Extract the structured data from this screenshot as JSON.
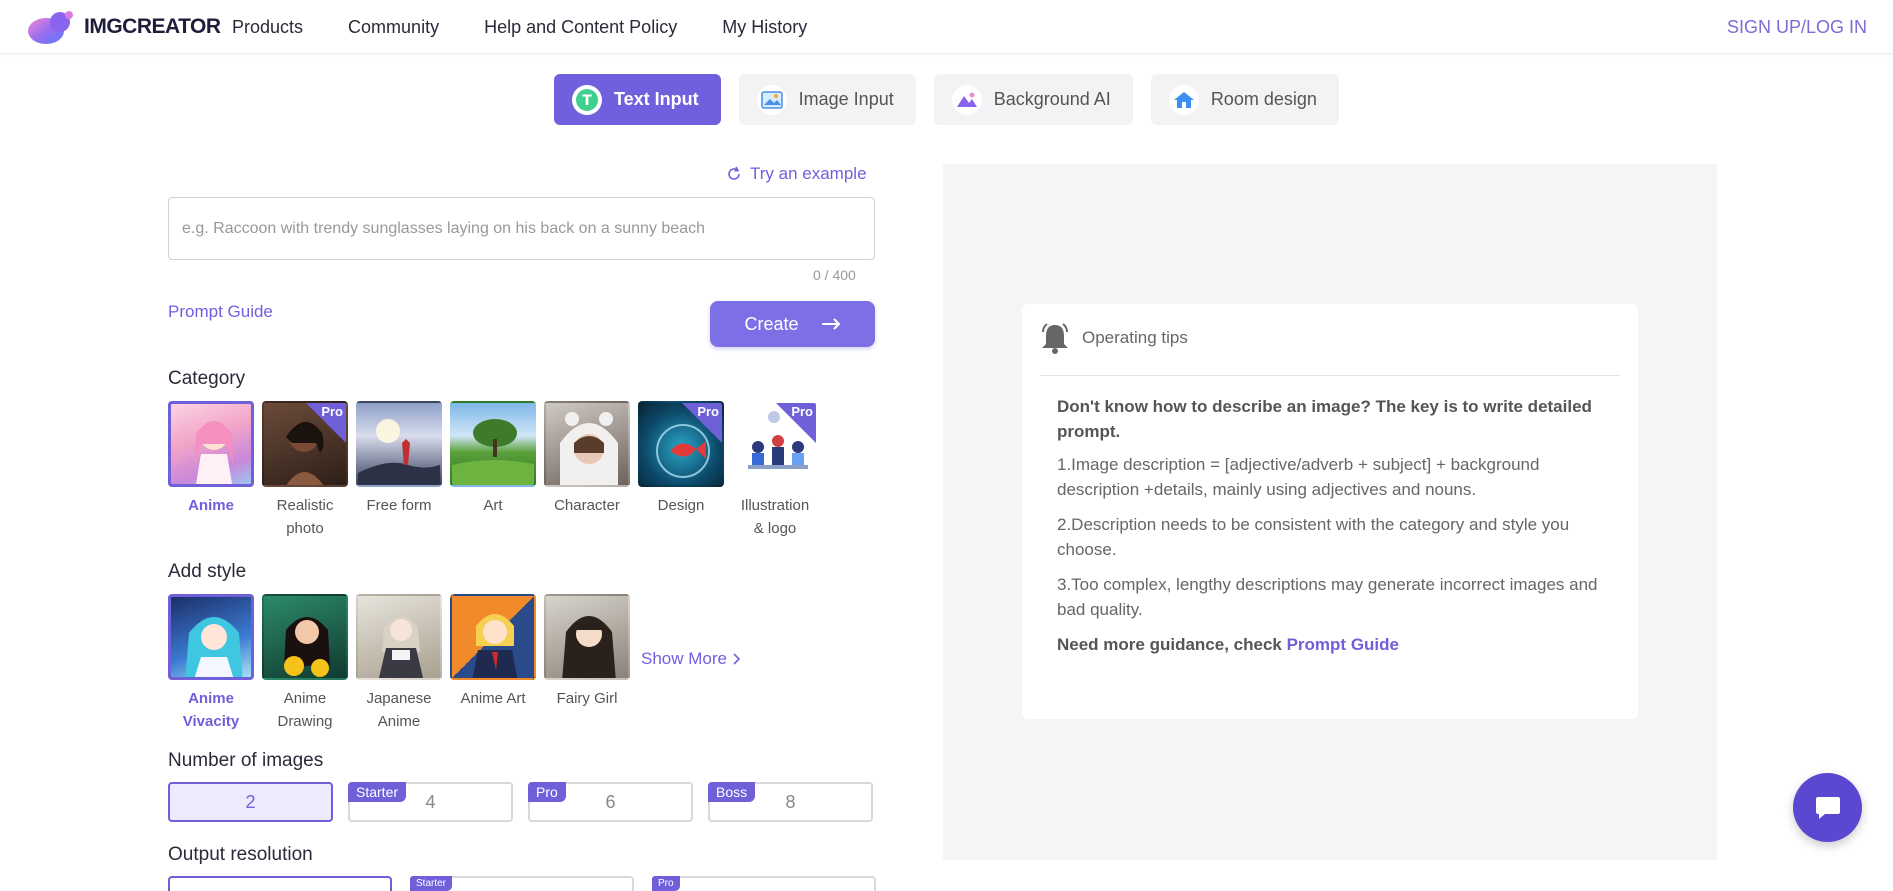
{
  "header": {
    "logo_text": "IMGCREATOR",
    "nav": [
      "Products",
      "Community",
      "Help and Content Policy",
      "My History"
    ],
    "signup": "SIGN UP/LOG IN"
  },
  "tabs": [
    {
      "label": "Text Input",
      "icon": "text-input-icon",
      "active": true
    },
    {
      "label": "Image Input",
      "icon": "image-icon",
      "active": false
    },
    {
      "label": "Background AI",
      "icon": "mountain-icon",
      "active": false
    },
    {
      "label": "Room design",
      "icon": "house-icon",
      "active": false
    }
  ],
  "prompt": {
    "try_example": "Try an example",
    "placeholder": "e.g. Raccoon with trendy sunglasses laying on his back on a sunny beach",
    "value": "",
    "counter": "0 / 400",
    "guide_link": "Prompt Guide",
    "create_label": "Create"
  },
  "category": {
    "title": "Category",
    "items": [
      {
        "label": "Anime",
        "pro": false,
        "selected": true
      },
      {
        "label": "Realistic photo",
        "pro": true,
        "selected": false
      },
      {
        "label": "Free form",
        "pro": false,
        "selected": false
      },
      {
        "label": "Art",
        "pro": false,
        "selected": false
      },
      {
        "label": "Character",
        "pro": false,
        "selected": false
      },
      {
        "label": "Design",
        "pro": true,
        "selected": false
      },
      {
        "label": "Illustration & logo",
        "pro": true,
        "selected": false
      }
    ],
    "pro_label": "Pro"
  },
  "style": {
    "title": "Add style",
    "items": [
      {
        "label": "Anime Vivacity",
        "selected": true
      },
      {
        "label": "Anime Drawing",
        "selected": false
      },
      {
        "label": "Japanese Anime",
        "selected": false
      },
      {
        "label": "Anime Art",
        "selected": false
      },
      {
        "label": "Fairy Girl",
        "selected": false
      }
    ],
    "show_more": "Show More"
  },
  "num_images": {
    "title": "Number of images",
    "options": [
      {
        "value": "2",
        "badge": "",
        "selected": true
      },
      {
        "value": "4",
        "badge": "Starter",
        "selected": false
      },
      {
        "value": "6",
        "badge": "Pro",
        "selected": false
      },
      {
        "value": "8",
        "badge": "Boss",
        "selected": false
      }
    ]
  },
  "resolution": {
    "title": "Output resolution",
    "options": [
      {
        "badge": "",
        "selected": true
      },
      {
        "badge": "Starter",
        "selected": false
      },
      {
        "badge": "Pro",
        "selected": false
      }
    ]
  },
  "tips": {
    "title": "Operating tips",
    "lead": "Don't know how to describe an image? The key is to write detailed prompt.",
    "points": [
      "1.Image description = [adjective/adverb + subject] + background description +details, mainly using adjectives and nouns.",
      "2.Description needs to be consistent with the category and style you choose.",
      "3.Too complex, lengthy descriptions may generate incorrect images and bad quality."
    ],
    "more_text": "Need more guidance, check ",
    "more_link": "Prompt Guide"
  },
  "colors": {
    "accent": "#7060dd",
    "accent_dark": "#5b48d0"
  }
}
